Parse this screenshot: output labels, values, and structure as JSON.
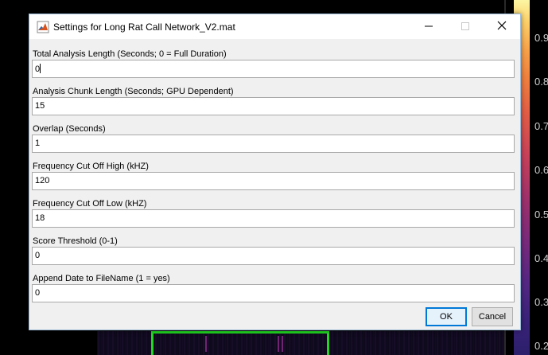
{
  "dialog": {
    "title": "Settings for Long Rat Call Network_V2.mat",
    "fields": [
      {
        "label": "Total Analysis Length (Seconds; 0 = Full Duration)",
        "value": "0"
      },
      {
        "label": "Analysis Chunk Length (Seconds; GPU Dependent)",
        "value": "15"
      },
      {
        "label": "Overlap (Seconds)",
        "value": "1"
      },
      {
        "label": "Frequency Cut Off High (kHZ)",
        "value": "120"
      },
      {
        "label": "Frequency Cut Off Low (kHZ)",
        "value": "18"
      },
      {
        "label": "Score Threshold (0-1)",
        "value": "0"
      },
      {
        "label": "Append Date to FileName (1 = yes)",
        "value": "0"
      }
    ],
    "buttons": {
      "ok": "OK",
      "cancel": "Cancel"
    }
  },
  "background": {
    "colorbar_ticks": [
      "0.9",
      "0.8",
      "0.7",
      "0.6",
      "0.5",
      "0.4",
      "0.3",
      "0.2"
    ],
    "selection_color": "#22d822"
  },
  "icons": {
    "app": "matlab-icon",
    "minimize": "minimize-icon",
    "maximize": "maximize-icon",
    "close": "close-icon"
  }
}
